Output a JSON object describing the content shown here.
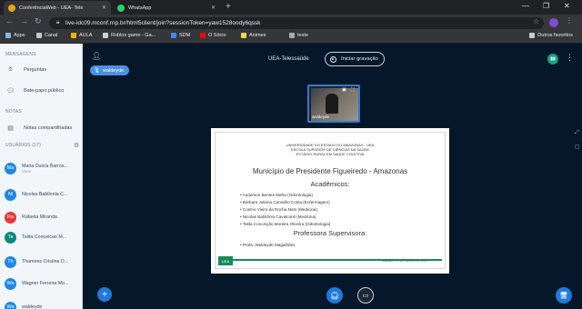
{
  "browser": {
    "tabs": [
      {
        "label": "ConferênciaWeb - UEA- Tele",
        "favicon_color": "#e8a317",
        "active": true
      },
      {
        "label": "WhatsApp",
        "favicon_color": "#25d366",
        "active": false
      }
    ],
    "url": "live-idc09.mconf.rnp.br/html5client/join?sessionToken=yaw1528oody6qssk",
    "bookmarks": [
      {
        "label": "Apps",
        "color": "#8ab4f8"
      },
      {
        "label": "Canal",
        "color": "#c9c9c9"
      },
      {
        "label": "AULA",
        "color": "#f4b400"
      },
      {
        "label": "Roblox game - Ga...",
        "color": "#d0d0d0"
      },
      {
        "label": "SDM",
        "color": "#4285f4"
      },
      {
        "label": "O Sócio",
        "color": "#ff0000"
      },
      {
        "label": "Animes",
        "color": "#ffd04d"
      },
      {
        "label": "teste",
        "color": "#aaaaaa"
      }
    ],
    "other_bookmarks": "Outros favoritos"
  },
  "sidebar": {
    "messages_heading": "MENSAGENS",
    "items": [
      {
        "label": "Perguntas",
        "icon": "hand-icon"
      },
      {
        "label": "Bate-papo público",
        "icon": "chat-icon"
      }
    ],
    "notes_heading": "NOTAS",
    "notes_item": {
      "label": "Notas compartilhadas",
      "icon": "notes-icon"
    },
    "users_heading": "USUÁRIOS (17)",
    "users": [
      {
        "initials": "Ma",
        "name": "Maria Dulcia Barros...",
        "sub": "Voce",
        "color": "#1e88e5"
      },
      {
        "initials": "Ni",
        "name": "Nicolas Babilonia C...",
        "sub": "",
        "color": "#1e88e5"
      },
      {
        "initials": "Ra",
        "name": "Rafaela Miranda",
        "sub": "",
        "color": "#e53935"
      },
      {
        "initials": "Ta",
        "name": "Talita Conceicao M...",
        "sub": "",
        "color": "#00897b"
      },
      {
        "initials": "Th",
        "name": "Thamires Cristina D...",
        "sub": "",
        "color": "#1e88e5"
      },
      {
        "initials": "Wa",
        "name": "Wagner Ferreira Mo...",
        "sub": "",
        "color": "#1e88e5"
      },
      {
        "initials": "Wa",
        "name": "waldeyde",
        "sub": "",
        "color": "#1e88e5"
      }
    ]
  },
  "header": {
    "user_chip": "waldeyde",
    "meeting_title": "UEA-Telessaúde",
    "record_label": "Iniciar gravação"
  },
  "webcam": {
    "label": "waldeyde"
  },
  "slide": {
    "inst1": "UNIVERSIDADE DO ESTADO DO AMAZONAS - UEA",
    "inst2": "ESCOLA SUPERIOR DE CIÊNCIAS DA SAÚDE",
    "inst3": "ESTÁGIO RURAL EM SAÚDE COLETIVA",
    "title": "Município de Presidente Figueiredo - Amazonas",
    "academics_heading": "Acadêmicos:",
    "academics": [
      "Anderson Bentes Mafra (Odontologia)",
      "Bárbara Juliana Carvalho Costa (Enfermagem)",
      "Cosmo Vieira da Rocha Neto (Medicina)",
      "Nicolas Babilônia Cavalcanti (Medicina)",
      "Talita Conceição Moreira Oliveira (Odontologia)"
    ],
    "supervisor_heading": "Professora Supervisora:",
    "supervisor": "Profa. Waldeyde Magalhães",
    "footer_date": "Manaus, 14 de Janeiro de 2021",
    "logo_text": "UEA"
  }
}
